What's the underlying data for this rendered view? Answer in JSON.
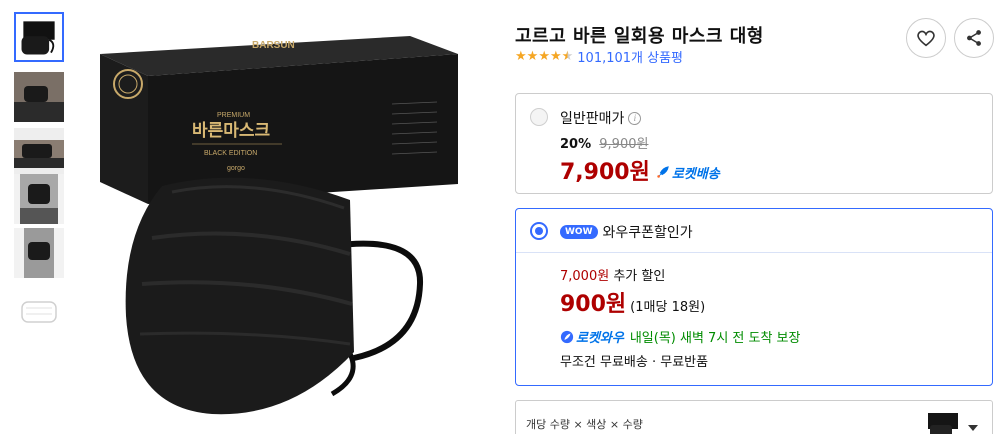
{
  "product": {
    "title": "고르고 바른 일회용 마스크 대형",
    "rating": 4.5,
    "review_text": "101,101개 상품평"
  },
  "thumbnails": [
    {
      "name": "product-box",
      "selected": true
    },
    {
      "name": "model-1",
      "selected": false
    },
    {
      "name": "model-2",
      "selected": false
    },
    {
      "name": "model-3",
      "selected": false
    },
    {
      "name": "model-4",
      "selected": false
    },
    {
      "name": "mask-outline",
      "selected": false
    }
  ],
  "main_image": {
    "box_premium": "PREMIUM",
    "box_brand": "바른마스크",
    "box_edition": "BLACK EDITION",
    "box_logo": "gorgo",
    "box_side": "BARSUN"
  },
  "actions": {
    "wishlist_icon": "heart-icon",
    "share_icon": "share-icon"
  },
  "general_option": {
    "label": "일반판매가",
    "discount_pct": "20%",
    "original_price": "9,900원",
    "price": "7,900원",
    "badge": "로켓배송"
  },
  "wow_option": {
    "badge": "WOW",
    "label": "와우쿠폰할인가",
    "extra_amount": "7,000원",
    "extra_text": "추가 할인",
    "price": "900원",
    "per_unit": "(1매당 18원)",
    "delivery_badge": "로켓와우",
    "delivery_text": "내일(목) 새벽 7시 전 도착 보장",
    "free_text": "무조건 무료배송 · 무료반품"
  },
  "option_selector": {
    "label": "개당 수량 × 색상 × 수량"
  },
  "colors": {
    "accent": "#346aff",
    "price_red": "#ae0000",
    "rocket_blue": "#0073e9",
    "delivery_green": "#008c00",
    "star": "#f5a623"
  }
}
